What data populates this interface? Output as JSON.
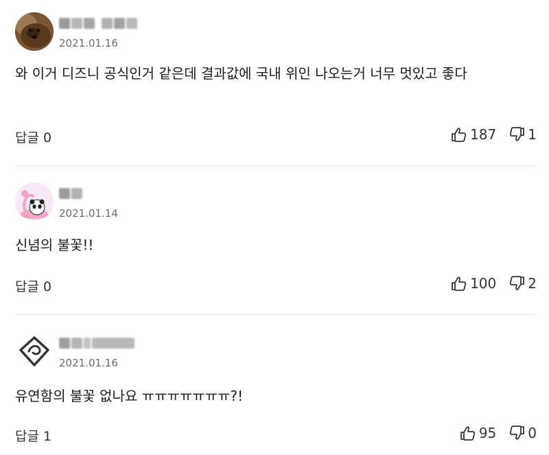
{
  "comments": [
    {
      "date": "2021.01.16",
      "text": "와 이거 디즈니 공식인거 같은데 결과값에 국내 위인 나오는거 너무 멋있고 좋다",
      "reply_label": "답글 0",
      "likes": "187",
      "dislikes": "1"
    },
    {
      "date": "2021.01.14",
      "text": "신념의 불꽃!!",
      "reply_label": "답글 0",
      "likes": "100",
      "dislikes": "2"
    },
    {
      "date": "2021.01.16",
      "text": "유연함의 불꽃 없나요 ㅠㅠㅠㅠㅠㅠㅠ?!",
      "reply_label": "답글 1",
      "likes": "95",
      "dislikes": "0"
    }
  ],
  "icons": {
    "like": "thumbs-up-icon",
    "dislike": "thumbs-down-icon"
  }
}
